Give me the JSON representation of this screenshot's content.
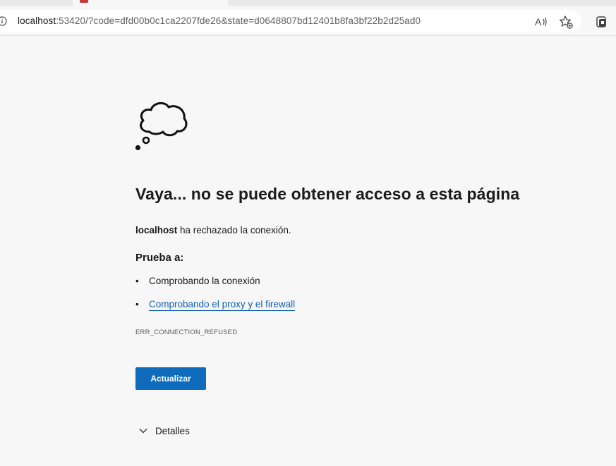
{
  "browser": {
    "url_host": "localhost",
    "url_rest": ":53420/?code=dfd00b0c1ca2207fde26&state=d0648807bd12401b8fa3bf22b2d25ad0"
  },
  "page": {
    "title": "Vaya... no se puede obtener acceso a esta página",
    "host": "localhost",
    "refused_text": " ha rechazado la conexión.",
    "try_heading": "Prueba a:",
    "suggestions": [
      {
        "bullet": "•",
        "label": "Comprobando la conexión"
      },
      {
        "bullet": "•",
        "label": "Comprobando el proxy y el firewall"
      }
    ],
    "error_code": "ERR_CONNECTION_REFUSED",
    "refresh_label": "Actualizar",
    "details_label": "Detalles"
  },
  "icons": {
    "info": "info-icon",
    "read_aloud": "read-aloud-icon",
    "favorite": "add-favorite-icon",
    "collections": "collections-icon",
    "cloud": "thought-cloud-icon",
    "chevron": "chevron-down-icon"
  },
  "colors": {
    "accent": "#0f6cbd",
    "link": "#0f5fb3",
    "background": "#f7f7f7"
  }
}
